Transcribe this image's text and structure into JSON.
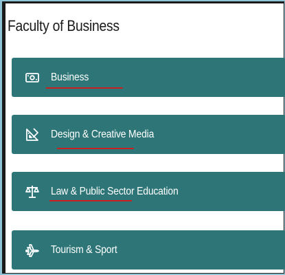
{
  "page": {
    "title": "Faculty of Business"
  },
  "menu": {
    "items": [
      {
        "label": "Business",
        "icon": "money-icon"
      },
      {
        "label": "Design & Creative Media",
        "icon": "design-tools-icon"
      },
      {
        "label": "Law & Public Sector Education",
        "icon": "scales-icon"
      },
      {
        "label": "Tourism & Sport",
        "icon": "airplane-icon"
      }
    ]
  },
  "colors": {
    "item_background": "#2d7577",
    "item_text": "#ffffff",
    "annotation_underline": "#cc1f1f",
    "frame_border": "#1a1a1a",
    "outer_background": "#8fc3d6"
  }
}
